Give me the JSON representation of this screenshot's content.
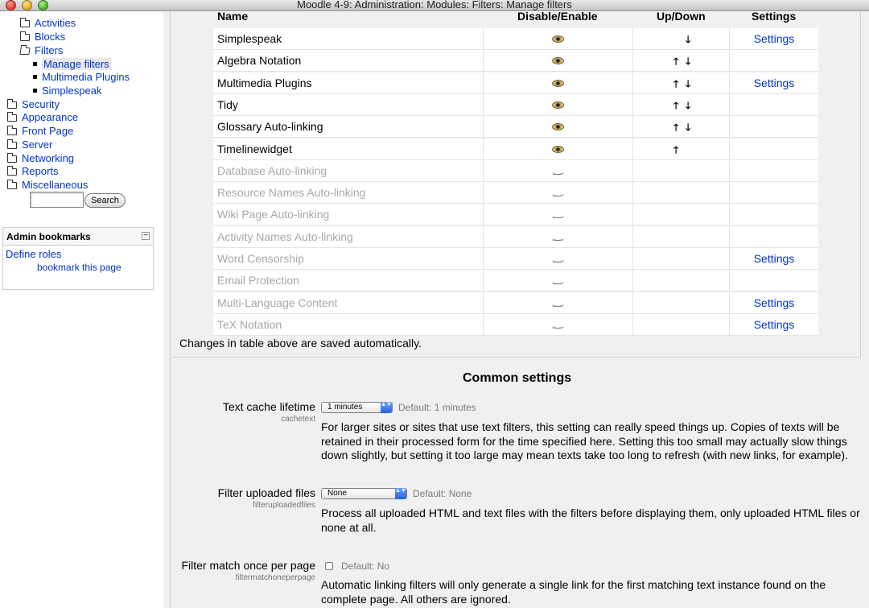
{
  "window": {
    "title": "Moodle 4-9: Administration: Modules: Filters: Manage filters"
  },
  "sidebar": {
    "tree": [
      {
        "label": "Activities",
        "kind": "folder"
      },
      {
        "label": "Blocks",
        "kind": "folder"
      },
      {
        "label": "Filters",
        "kind": "folder-open"
      },
      {
        "label": "Manage filters",
        "kind": "leaf"
      },
      {
        "label": "Multimedia Plugins",
        "kind": "leaf"
      },
      {
        "label": "Simplespeak",
        "kind": "leaf"
      },
      {
        "label": "Security",
        "kind": "folder"
      },
      {
        "label": "Appearance",
        "kind": "folder"
      },
      {
        "label": "Front Page",
        "kind": "folder"
      },
      {
        "label": "Server",
        "kind": "folder"
      },
      {
        "label": "Networking",
        "kind": "folder"
      },
      {
        "label": "Reports",
        "kind": "folder"
      },
      {
        "label": "Miscellaneous",
        "kind": "folder"
      }
    ],
    "search_button": "Search",
    "search_value": ""
  },
  "bookmarks": {
    "title": "Admin bookmarks",
    "collapse_glyph": "−",
    "define_roles": "Define roles",
    "bookmark_page": "bookmark this page"
  },
  "filters_table": {
    "headers": {
      "name": "Name",
      "enable": "Disable/Enable",
      "updown": "Up/Down",
      "settings": "Settings"
    },
    "rows": [
      {
        "name": "Simplespeak",
        "enabled": true,
        "up": false,
        "down": true,
        "settings": "Settings"
      },
      {
        "name": "Algebra Notation",
        "enabled": true,
        "up": true,
        "down": true,
        "settings": ""
      },
      {
        "name": "Multimedia Plugins",
        "enabled": true,
        "up": true,
        "down": true,
        "settings": "Settings"
      },
      {
        "name": "Tidy",
        "enabled": true,
        "up": true,
        "down": true,
        "settings": ""
      },
      {
        "name": "Glossary Auto-linking",
        "enabled": true,
        "up": true,
        "down": true,
        "settings": ""
      },
      {
        "name": "Timelinewidget",
        "enabled": true,
        "up": true,
        "down": false,
        "settings": ""
      },
      {
        "name": "Database Auto-linking",
        "enabled": false,
        "up": false,
        "down": false,
        "settings": ""
      },
      {
        "name": "Resource Names Auto-linking",
        "enabled": false,
        "up": false,
        "down": false,
        "settings": ""
      },
      {
        "name": "Wiki Page Auto-linking",
        "enabled": false,
        "up": false,
        "down": false,
        "settings": ""
      },
      {
        "name": "Activity Names Auto-linking",
        "enabled": false,
        "up": false,
        "down": false,
        "settings": ""
      },
      {
        "name": "Word Censorship",
        "enabled": false,
        "up": false,
        "down": false,
        "settings": "Settings"
      },
      {
        "name": "Email Protection",
        "enabled": false,
        "up": false,
        "down": false,
        "settings": ""
      },
      {
        "name": "Multi-Language Content",
        "enabled": false,
        "up": false,
        "down": false,
        "settings": "Settings"
      },
      {
        "name": "TeX Notation",
        "enabled": false,
        "up": false,
        "down": false,
        "settings": "Settings"
      }
    ],
    "saved_note": "Changes in table above are saved automatically."
  },
  "common": {
    "title": "Common settings",
    "text_cache": {
      "label": "Text cache lifetime",
      "sub": "cachetext",
      "value": "1 minutes",
      "default": "Default: 1 minutes",
      "desc": "For larger sites or sites that use text filters, this setting can really speed things up. Copies of texts will be retained in their processed form for the time specified here. Setting this too small may actually slow things down slightly, but setting it too large may mean texts take too long to refresh (with new links, for example)."
    },
    "uploaded": {
      "label": "Filter uploaded files",
      "sub": "filteruploadedfiles",
      "value": "None",
      "default": "Default: None",
      "desc": "Process all uploaded HTML and text files with the filters before displaying them, only uploaded HTML files or none at all."
    },
    "match_once": {
      "label": "Filter match once per page",
      "sub": "filtermatchoneperpage",
      "checked": false,
      "default": "Default: No",
      "desc": "Automatic linking filters will only generate a single link for the first matching text instance found on the complete page. All others are ignored."
    }
  },
  "glyphs": {
    "up_arrow": "🡑",
    "down_arrow": "🡓",
    "caret": "▲▼"
  }
}
